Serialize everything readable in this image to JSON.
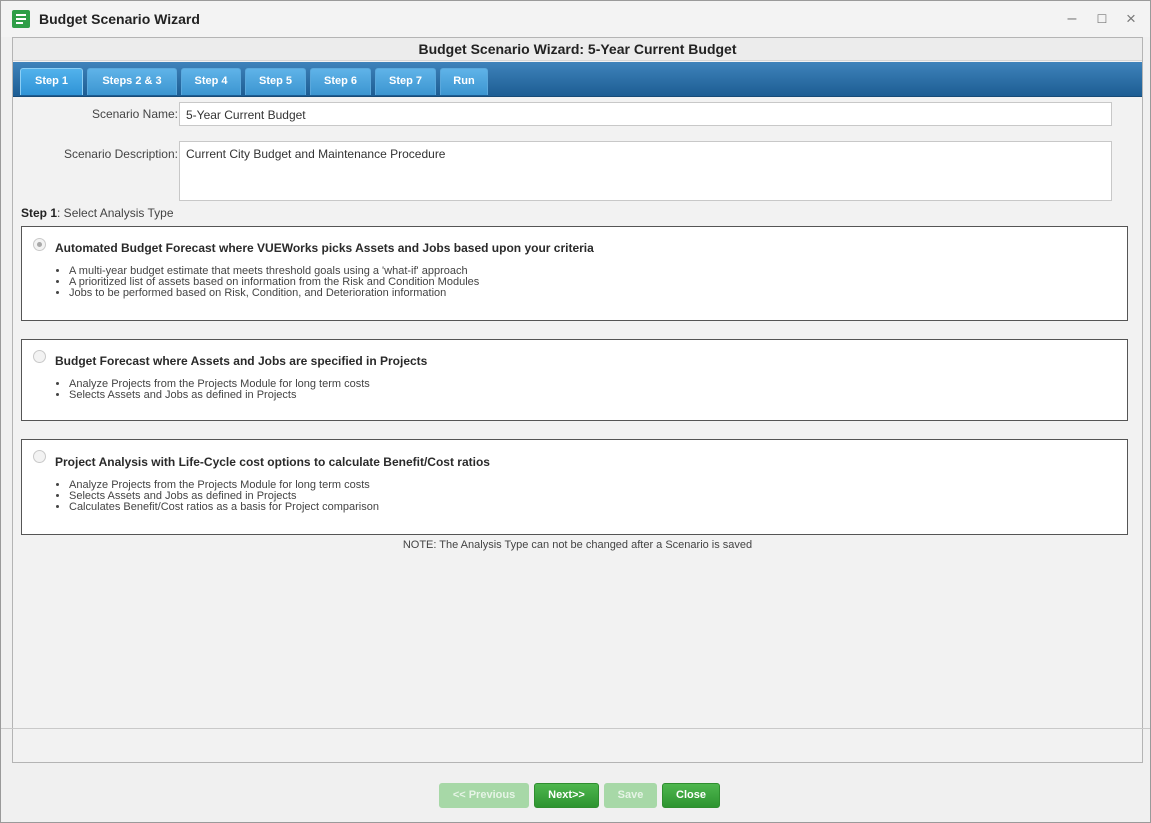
{
  "window": {
    "title": "Budget Scenario Wizard",
    "icon": "form-icon"
  },
  "dialog": {
    "header": "Budget Scenario Wizard: 5-Year Current Budget"
  },
  "tabs": [
    {
      "label": "Step 1"
    },
    {
      "label": "Steps 2 & 3"
    },
    {
      "label": "Step 4"
    },
    {
      "label": "Step 5"
    },
    {
      "label": "Step 6"
    },
    {
      "label": "Step 7"
    },
    {
      "label": "Run"
    }
  ],
  "form": {
    "scenario_name_label": "Scenario Name:",
    "scenario_name_value": "5-Year Current Budget",
    "scenario_description_label": "Scenario Description:",
    "scenario_description_value": "Current City Budget and Maintenance Procedure"
  },
  "step": {
    "prefix": "Step 1",
    "text": ": Select Analysis Type"
  },
  "options": [
    {
      "title": "Automated Budget Forecast where VUEWorks picks Assets and Jobs based upon your criteria",
      "selected": true,
      "bullets": [
        "A multi-year budget estimate that meets threshold goals using a 'what-if' approach",
        "A prioritized list of assets based on information from the Risk and Condition Modules",
        "Jobs to be performed based on Risk, Condition, and Deterioration information"
      ]
    },
    {
      "title": "Budget Forecast where Assets and Jobs are specified in Projects",
      "selected": false,
      "bullets": [
        "Analyze Projects from the Projects Module for long term costs",
        "Selects Assets and Jobs as defined in Projects"
      ]
    },
    {
      "title": "Project Analysis with Life-Cycle cost options to calculate Benefit/Cost ratios",
      "selected": false,
      "bullets": [
        "Analyze Projects from the Projects Module for long term costs",
        "Selects Assets and Jobs as defined in Projects",
        "Calculates Benefit/Cost ratios as a basis for Project comparison"
      ]
    }
  ],
  "note": "NOTE: The Analysis Type can not be changed after a Scenario is saved",
  "buttons": {
    "previous": "<< Previous",
    "next": "Next>>",
    "save": "Save",
    "close": "Close"
  },
  "colors": {
    "tab_bar": "#1d5d93",
    "tab": "#3c95d0",
    "button": "#2d9430",
    "button_disabled": "#a7d8a7"
  }
}
